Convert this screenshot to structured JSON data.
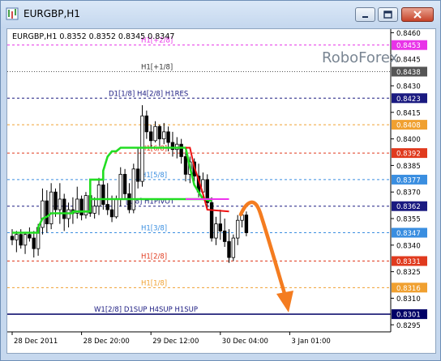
{
  "window": {
    "title": "EURGBP,H1",
    "buttons": [
      "minimize",
      "restore",
      "close"
    ]
  },
  "chart_data": {
    "type": "candlestick",
    "header": "EURGBP,H1  0.8352 0.8352 0.8345 0.8347",
    "watermark": "RoboForex",
    "ylim": [
      0.8291,
      0.8462
    ],
    "price_ticks": [
      "0.8460",
      "0.8445",
      "0.8430",
      "0.8415",
      "0.8400",
      "0.8385",
      "0.8370",
      "0.8355",
      "0.8340",
      "0.8325",
      "0.8310",
      "0.8295"
    ],
    "time_ticks": [
      {
        "label": "28 Dec 2011",
        "x": 0
      },
      {
        "label": "28 Dec 20:00",
        "x": 16
      },
      {
        "label": "29 Dec 12:00",
        "x": 32
      },
      {
        "label": "30 Dec 04:00",
        "x": 48
      },
      {
        "label": "3 Jan 01:00",
        "x": 64
      }
    ],
    "levels": [
      {
        "price": 0.8453,
        "value": "0.8453",
        "label": "H1[+2/8]",
        "color": "#e833e8",
        "style": "dashed",
        "label_color": "#e833e8"
      },
      {
        "price": 0.8438,
        "value": "0.8438",
        "label": "H1[+1/8]",
        "color": "#555555",
        "style": "dotted",
        "label_color": "#333333"
      },
      {
        "price": 0.8423,
        "value": "0.8423",
        "label": "D1[1/8] H4[2/8] H1RES",
        "color": "#1a1a80",
        "style": "dashed",
        "label_color": "#1a1a80"
      },
      {
        "price": 0.8408,
        "value": "0.8408",
        "label": "",
        "color": "#f0a030",
        "style": "dashed",
        "label_color": "#f0a030"
      },
      {
        "price": 0.8392,
        "value": "0.8392",
        "label": "H1[6/8]",
        "color": "#e03a1e",
        "style": "dashed",
        "label_color": "#e03a1e"
      },
      {
        "price": 0.8377,
        "value": "0.8377",
        "label": "H1[5/8]",
        "color": "#3a8ee0",
        "style": "dashed",
        "label_color": "#3a8ee0"
      },
      {
        "price": 0.8362,
        "value": "0.8362",
        "label": "[1/8] H1PIVOT",
        "color": "#1a1a80",
        "style": "dashed",
        "label_color": "#1a1a80"
      },
      {
        "price": 0.8347,
        "value": "0.8347",
        "label": "H1[3/8]",
        "color": "#3a8ee0",
        "style": "dashed",
        "label_color": "#3a8ee0"
      },
      {
        "price": 0.8331,
        "value": "0.8331",
        "label": "H1[2/8]",
        "color": "#e03a1e",
        "style": "dashed",
        "label_color": "#e03a1e"
      },
      {
        "price": 0.8316,
        "value": "0.8316",
        "label": "H1[1/8]",
        "color": "#f0a030",
        "style": "dashed",
        "label_color": "#f0a030"
      },
      {
        "price": 0.8301,
        "value": "0.8301",
        "label": "W1[2/8] D1SUP H4SUP H1SUP",
        "color": "#000066",
        "style": "solid",
        "label_color": "#1a1a80"
      }
    ],
    "ohlc": [
      [
        0.8345,
        0.8349,
        0.834,
        0.8343
      ],
      [
        0.8343,
        0.8348,
        0.8336,
        0.8346
      ],
      [
        0.8346,
        0.8349,
        0.8338,
        0.834
      ],
      [
        0.834,
        0.8347,
        0.8335,
        0.8346
      ],
      [
        0.8346,
        0.835,
        0.8342,
        0.8344
      ],
      [
        0.8344,
        0.8348,
        0.8333,
        0.8338
      ],
      [
        0.8338,
        0.8352,
        0.8334,
        0.835
      ],
      [
        0.835,
        0.8372,
        0.8346,
        0.8365
      ],
      [
        0.8365,
        0.8371,
        0.8347,
        0.8352
      ],
      [
        0.8352,
        0.8375,
        0.8349,
        0.837
      ],
      [
        0.837,
        0.8372,
        0.8356,
        0.836
      ],
      [
        0.836,
        0.8375,
        0.8352,
        0.8366
      ],
      [
        0.8366,
        0.8369,
        0.8348,
        0.8355
      ],
      [
        0.8355,
        0.8364,
        0.835,
        0.836
      ],
      [
        0.836,
        0.8367,
        0.8352,
        0.8358
      ],
      [
        0.8358,
        0.8373,
        0.8355,
        0.8366
      ],
      [
        0.8366,
        0.8368,
        0.8354,
        0.8357
      ],
      [
        0.8357,
        0.837,
        0.8355,
        0.8368
      ],
      [
        0.8368,
        0.837,
        0.8356,
        0.8358
      ],
      [
        0.8358,
        0.8367,
        0.8355,
        0.8362
      ],
      [
        0.8362,
        0.8378,
        0.8357,
        0.8374
      ],
      [
        0.8374,
        0.838,
        0.836,
        0.8363
      ],
      [
        0.8363,
        0.8375,
        0.8357,
        0.836
      ],
      [
        0.836,
        0.8368,
        0.8353,
        0.8356
      ],
      [
        0.8356,
        0.8368,
        0.8355,
        0.8366
      ],
      [
        0.8366,
        0.8384,
        0.8362,
        0.838
      ],
      [
        0.838,
        0.8383,
        0.8366,
        0.8369
      ],
      [
        0.8369,
        0.8375,
        0.8358,
        0.836
      ],
      [
        0.836,
        0.8386,
        0.8358,
        0.8383
      ],
      [
        0.8383,
        0.8395,
        0.8372,
        0.8376
      ],
      [
        0.8376,
        0.8419,
        0.8373,
        0.8413
      ],
      [
        0.8413,
        0.8416,
        0.84,
        0.8404
      ],
      [
        0.8404,
        0.8408,
        0.8395,
        0.8399
      ],
      [
        0.8399,
        0.841,
        0.8398,
        0.8407
      ],
      [
        0.8407,
        0.8408,
        0.8396,
        0.84
      ],
      [
        0.84,
        0.8409,
        0.8397,
        0.8404
      ],
      [
        0.8404,
        0.8407,
        0.8393,
        0.8398
      ],
      [
        0.8398,
        0.8404,
        0.839,
        0.8394
      ],
      [
        0.8394,
        0.8401,
        0.8389,
        0.8397
      ],
      [
        0.8397,
        0.84,
        0.8386,
        0.839
      ],
      [
        0.839,
        0.8394,
        0.8376,
        0.838
      ],
      [
        0.838,
        0.839,
        0.8375,
        0.8387
      ],
      [
        0.8387,
        0.8389,
        0.8376,
        0.8379
      ],
      [
        0.8379,
        0.8386,
        0.8367,
        0.837
      ],
      [
        0.837,
        0.8381,
        0.8366,
        0.8377
      ],
      [
        0.8377,
        0.838,
        0.836,
        0.8364
      ],
      [
        0.8364,
        0.8367,
        0.8342,
        0.8344
      ],
      [
        0.8344,
        0.8356,
        0.834,
        0.8352
      ],
      [
        0.8352,
        0.836,
        0.8343,
        0.8348
      ],
      [
        0.8348,
        0.8355,
        0.8339,
        0.8342
      ],
      [
        0.8342,
        0.8349,
        0.833,
        0.8333
      ],
      [
        0.8333,
        0.8346,
        0.8331,
        0.8344
      ],
      [
        0.8344,
        0.8357,
        0.834,
        0.8354
      ],
      [
        0.8354,
        0.836,
        0.835,
        0.8357
      ],
      [
        0.8357,
        0.8359,
        0.8345,
        0.8347
      ]
    ],
    "green_steps": [
      [
        0,
        0.8347
      ],
      [
        6,
        0.8347
      ],
      [
        6,
        0.835
      ],
      [
        7,
        0.8355
      ],
      [
        8,
        0.8356
      ],
      [
        9,
        0.8358
      ],
      [
        14,
        0.8358
      ],
      [
        14,
        0.8359
      ],
      [
        18,
        0.8359
      ],
      [
        18,
        0.8377
      ],
      [
        21,
        0.8377
      ],
      [
        21,
        0.8382
      ],
      [
        22,
        0.839
      ],
      [
        23,
        0.8393
      ],
      [
        24,
        0.8393
      ],
      [
        25,
        0.8395
      ],
      [
        40,
        0.8395
      ],
      [
        41,
        0.8384
      ],
      [
        42,
        0.8374
      ],
      [
        44,
        0.8366
      ],
      [
        46,
        0.8365
      ]
    ],
    "green_pivot": [
      [
        18,
        0.8366
      ],
      [
        46,
        0.8366
      ]
    ],
    "red_line": [
      [
        40,
        0.8395
      ],
      [
        41,
        0.8395
      ],
      [
        42,
        0.8384
      ],
      [
        43,
        0.8377
      ],
      [
        44,
        0.8369
      ],
      [
        45,
        0.836
      ],
      [
        50,
        0.8359
      ]
    ],
    "magenta_line": [
      [
        40,
        0.8366
      ],
      [
        50,
        0.8366
      ]
    ],
    "projection_arrow": "down"
  }
}
